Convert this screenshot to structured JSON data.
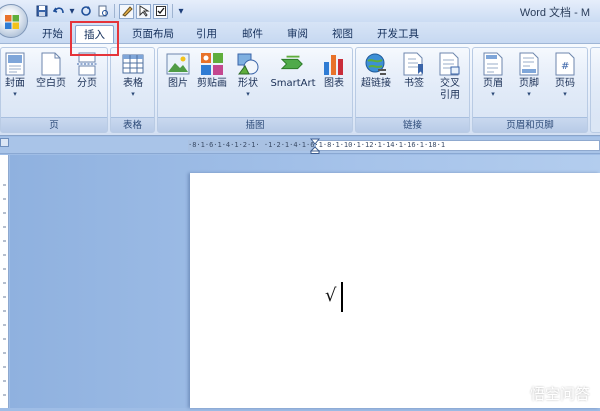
{
  "window": {
    "title": "Word 文档 - M"
  },
  "quick_access": {
    "save": "💾",
    "undo": "↶",
    "undo_dropdown": "▾",
    "redo": "↻",
    "print_preview": "🖹",
    "customize": "▾"
  },
  "tabs": [
    {
      "label": "开始"
    },
    {
      "label": "插入",
      "active": true
    },
    {
      "label": "页面布局"
    },
    {
      "label": "引用"
    },
    {
      "label": "邮件"
    },
    {
      "label": "审阅"
    },
    {
      "label": "视图"
    },
    {
      "label": "开发工具"
    }
  ],
  "ribbon": {
    "groups": [
      {
        "label": "页",
        "buttons": [
          {
            "label": "封面",
            "dropdown": true
          },
          {
            "label": "空白页"
          },
          {
            "label": "分页"
          }
        ]
      },
      {
        "label": "表格",
        "buttons": [
          {
            "label": "表格",
            "dropdown": true
          }
        ]
      },
      {
        "label": "插图",
        "buttons": [
          {
            "label": "图片"
          },
          {
            "label": "剪贴画"
          },
          {
            "label": "形状",
            "dropdown": true
          },
          {
            "label": "SmartArt"
          },
          {
            "label": "图表"
          }
        ]
      },
      {
        "label": "链接",
        "buttons": [
          {
            "label": "超链接"
          },
          {
            "label": "书签"
          },
          {
            "label": "交叉\n引用"
          }
        ]
      },
      {
        "label": "页眉和页脚",
        "buttons": [
          {
            "label": "页眉",
            "dropdown": true
          },
          {
            "label": "页脚",
            "dropdown": true
          },
          {
            "label": "页码",
            "dropdown": true
          }
        ]
      }
    ]
  },
  "ruler": {
    "marks": "·8·1·6·1·4·1·2·1·  ·1·2·1·4·1·6·1·8·1·10·1·12·1·14·1·16·1·18·1"
  },
  "document": {
    "content": "√"
  },
  "watermark": {
    "text": "悟空问答"
  },
  "colors": {
    "highlight": "#e5343a",
    "ribbon_accent": "#c6d8f1"
  }
}
